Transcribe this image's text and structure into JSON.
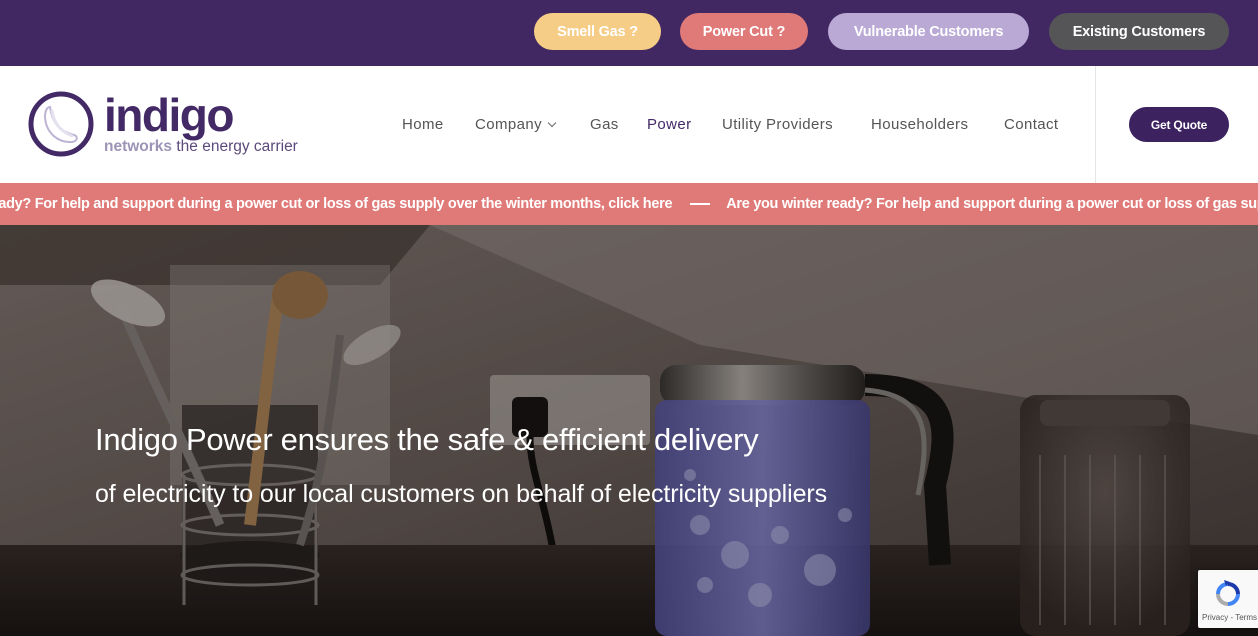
{
  "topbar": {
    "buttons": [
      {
        "label": "Smell Gas ?",
        "color": "#f6cd86"
      },
      {
        "label": "Power Cut ?",
        "color": "#e07a78"
      },
      {
        "label": "Vulnerable Customers",
        "color": "#b9a9d4"
      },
      {
        "label": "Existing Customers",
        "color": "#555457"
      }
    ],
    "background": "#412862"
  },
  "logo": {
    "wordmark": "indigo",
    "tagline_part1": "networks",
    "tagline_part2": "the energy carrier"
  },
  "nav": {
    "items": [
      {
        "label": "Home"
      },
      {
        "label": "Company",
        "has_dropdown": true
      },
      {
        "label": "Gas"
      },
      {
        "label": "Power",
        "active": true
      },
      {
        "label": "Utility Providers"
      },
      {
        "label": "Householders"
      },
      {
        "label": "Contact"
      }
    ],
    "cta_label": "Get Quote"
  },
  "ticker": {
    "message": "Are you winter ready? For help and support during a power cut or loss of gas supply over the winter months, click here",
    "background": "#e07a78"
  },
  "hero": {
    "title": "Indigo Power ensures the safe & efficient delivery",
    "subtitle": "of electricity to our local customers on behalf of electricity suppliers"
  },
  "recaptcha": {
    "privacy": "Privacy",
    "separator": "-",
    "terms": "Terms"
  },
  "colors": {
    "brand_purple": "#432a67",
    "accent_pink": "#e07a78",
    "accent_yellow": "#f6cd86",
    "accent_lilac": "#b9a9d4",
    "accent_grey": "#555457"
  }
}
